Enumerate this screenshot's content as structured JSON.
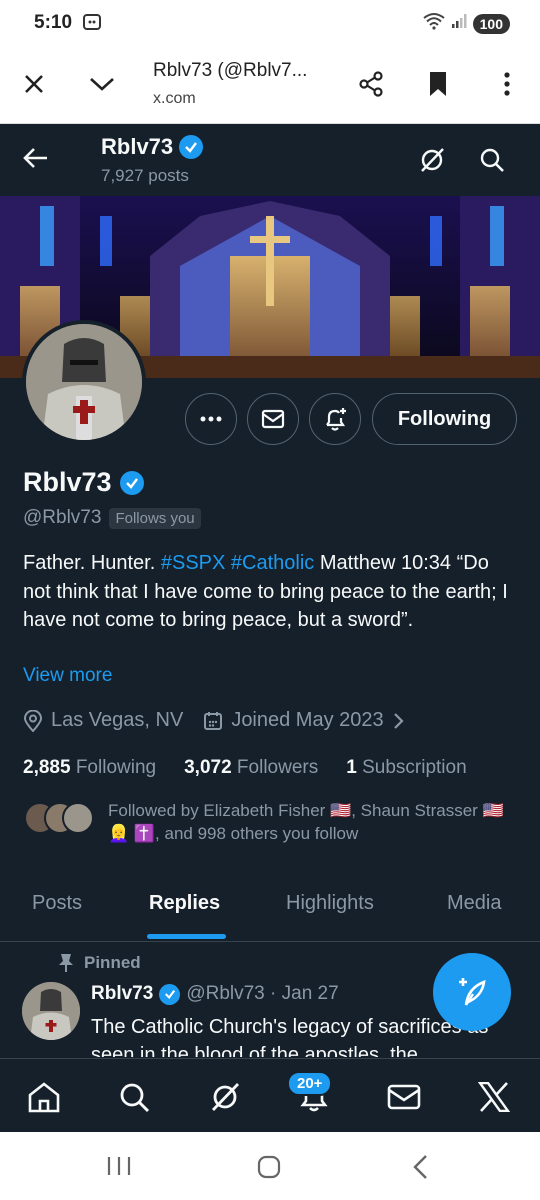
{
  "status_bar": {
    "time": "5:10",
    "battery": "100"
  },
  "browser": {
    "title": "Rblv73 (@Rblv7...",
    "url": "x.com"
  },
  "header": {
    "name": "Rblv73",
    "posts": "7,927 posts"
  },
  "profile": {
    "name": "Rblv73",
    "handle": "@Rblv73",
    "follows_you": "Follows you",
    "following_label": "Following",
    "bio_text_1": "Father. Hunter. ",
    "bio_tag_1": "#SSPX",
    "bio_space": " ",
    "bio_tag_2": "#Catholic",
    "bio_text_2": " Matthew 10:34 “Do not think that I have come to bring peace to the earth; I have not come to bring peace, but a sword”.",
    "view_more": "View more",
    "location": "Las Vegas, NV",
    "joined": "Joined May 2023",
    "stats": {
      "following_count": "2,885",
      "following_label": "Following",
      "followers_count": "3,072",
      "followers_label": "Followers",
      "subs_count": "1",
      "subs_label": "Subscription"
    },
    "followed_by": "Followed by Elizabeth Fisher 🇺🇸, Shaun Strasser 🇺🇸 👱‍♀️ ✝️, and 998 others you follow"
  },
  "tabs": [
    "Posts",
    "Replies",
    "Highlights",
    "Media"
  ],
  "pinned_post": {
    "label": "Pinned",
    "name": "Rblv73",
    "meta": "@Rblv73 · Jan 27",
    "text": "The Catholic Church's legacy of sacrifices as seen in the blood of the apostles, the"
  },
  "bottom_nav": {
    "notifications_badge": "20+"
  },
  "colors": {
    "background": "#15202b",
    "accent": "#1d9bf0",
    "muted": "#8b98a5"
  }
}
